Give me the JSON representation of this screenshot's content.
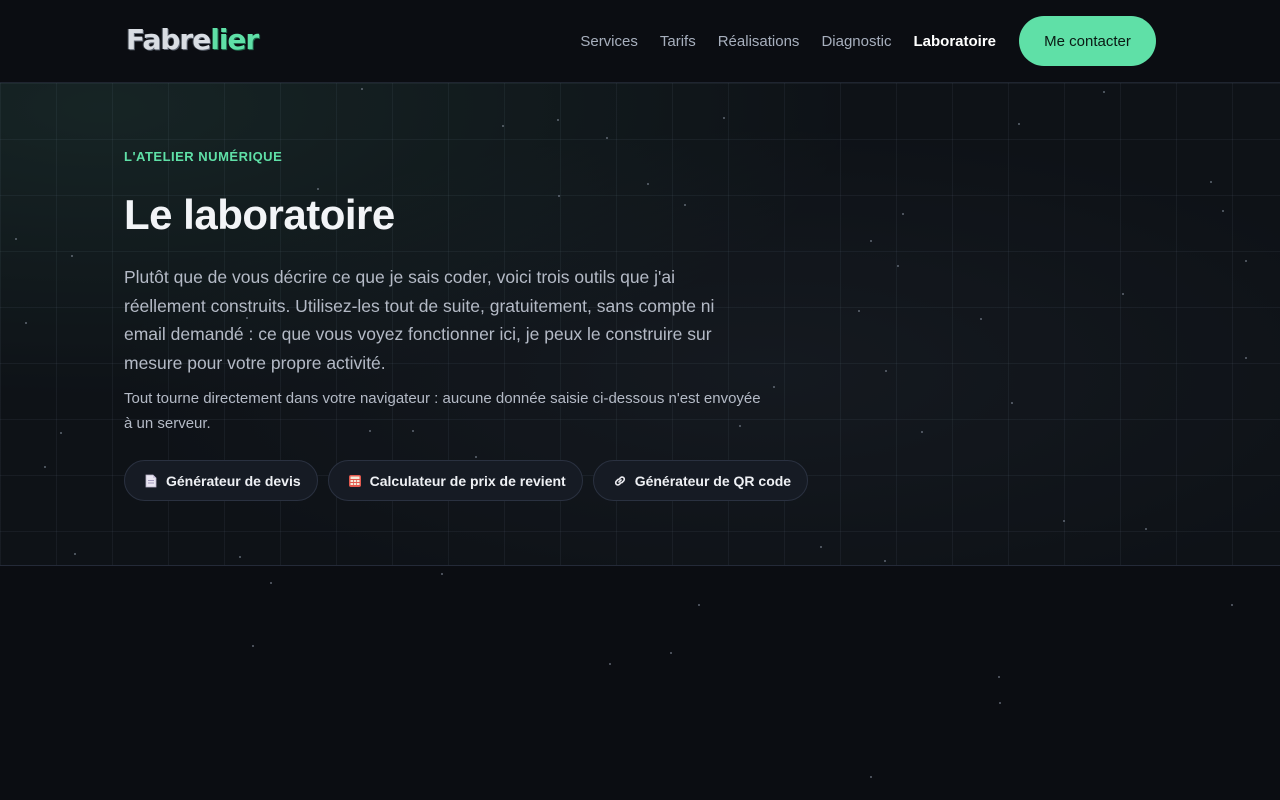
{
  "header": {
    "logo_part1": "Fabre",
    "logo_part2": "lier",
    "nav": [
      "Services",
      "Tarifs",
      "Réalisations",
      "Diagnostic",
      "Laboratoire"
    ],
    "active_nav": "Laboratoire",
    "cta_label": "Me contacter"
  },
  "hero": {
    "eyebrow": "L'ATELIER NUMÉRIQUE",
    "title": "Le laboratoire",
    "lead": "Plutôt que de vous décrire ce que je sais coder, voici trois outils que j'ai réellement construits. Utilisez-les tout de suite, gratuitement, sans compte ni email demandé : ce que vous voyez fonctionner ici, je peux le construire sur mesure pour votre propre activité.",
    "note": "Tout tourne directement dans votre navigateur : aucune donnée saisie ci-dessous n'est envoyée à un serveur.",
    "tools": [
      {
        "label": "Générateur de devis",
        "icon": "document-icon"
      },
      {
        "label": "Calculateur de prix de revient",
        "icon": "calculator-icon"
      },
      {
        "label": "Générateur de QR code",
        "icon": "link-icon"
      }
    ]
  },
  "colors": {
    "accent": "#5fe0a7",
    "background": "#0b0d12",
    "hero_background": "#0e1217"
  }
}
